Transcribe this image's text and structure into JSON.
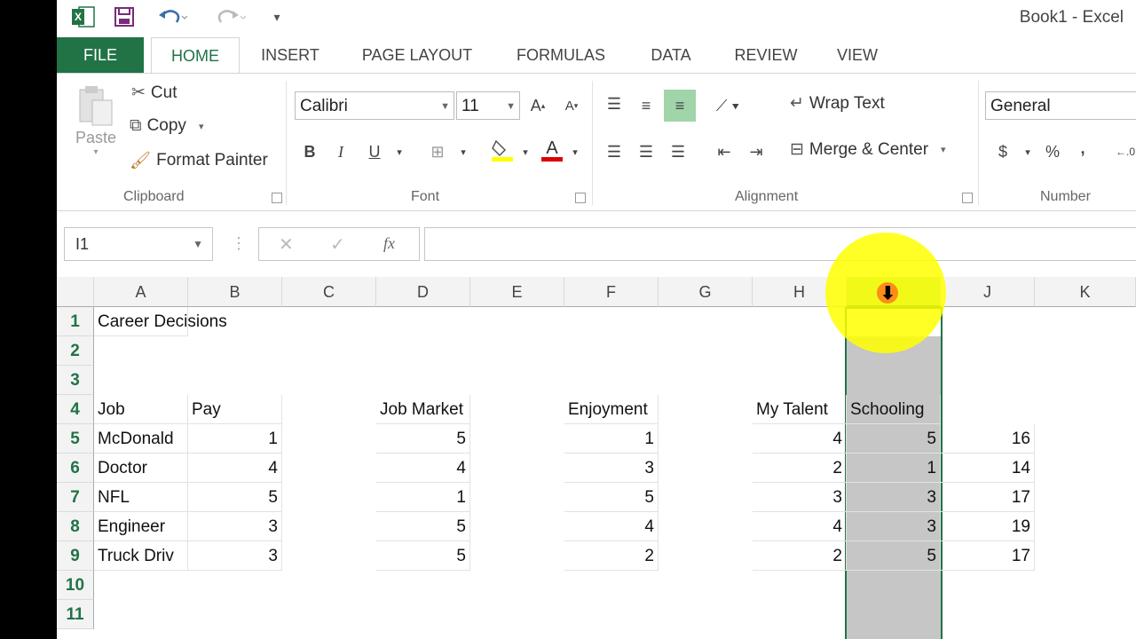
{
  "app": {
    "title": "Book1 - Excel"
  },
  "tabs": [
    "FILE",
    "HOME",
    "INSERT",
    "PAGE LAYOUT",
    "FORMULAS",
    "DATA",
    "REVIEW",
    "VIEW"
  ],
  "ribbon": {
    "clipboard": {
      "paste": "Paste",
      "cut": "Cut",
      "copy": "Copy",
      "format_painter": "Format Painter",
      "label": "Clipboard"
    },
    "font": {
      "name": "Calibri",
      "size": "11",
      "bold": "B",
      "italic": "I",
      "underline": "U",
      "grow": "A",
      "shrink": "A",
      "color_letter": "A",
      "label": "Font"
    },
    "alignment": {
      "wrap": "Wrap Text",
      "merge": "Merge & Center",
      "label": "Alignment"
    },
    "number": {
      "format": "General",
      "currency": "$",
      "percent": "%",
      "comma": ",",
      "label": "Number"
    }
  },
  "formula_bar": {
    "name_box": "I1",
    "cancel": "✕",
    "enter": "✓",
    "fx": "fx",
    "value": ""
  },
  "grid": {
    "columns": [
      "A",
      "B",
      "C",
      "D",
      "E",
      "F",
      "G",
      "H",
      "I",
      "J",
      "K"
    ],
    "rows": [
      "1",
      "2",
      "3",
      "4",
      "5",
      "6",
      "7",
      "8",
      "9",
      "10",
      "11"
    ],
    "cells": {
      "a1": "Career Decisions",
      "a4": "Job",
      "b4": "Pay",
      "d4": "Job Market",
      "f4": "Enjoyment",
      "h4": "My Talent",
      "i4": "Schooling",
      "a5": "McDonald",
      "b5": "1",
      "d5": "5",
      "f5": "1",
      "h5": "4",
      "i5": "5",
      "j5": "16",
      "a6": "Doctor",
      "b6": "4",
      "d6": "4",
      "f6": "3",
      "h6": "2",
      "i6": "1",
      "j6": "14",
      "a7": "NFL",
      "b7": "5",
      "d7": "1",
      "f7": "5",
      "h7": "3",
      "i7": "3",
      "j7": "17",
      "a8": "Engineer",
      "b8": "3",
      "d8": "5",
      "f8": "4",
      "h8": "4",
      "i8": "3",
      "j8": "19",
      "a9": "Truck Driv",
      "b9": "3",
      "d9": "5",
      "f9": "2",
      "h9": "2",
      "i9": "5",
      "j9": "17"
    },
    "selected_column": "I"
  },
  "colors": {
    "accent": "#217346",
    "selection": "#c6c6c6",
    "highlight": "#ffff00"
  }
}
